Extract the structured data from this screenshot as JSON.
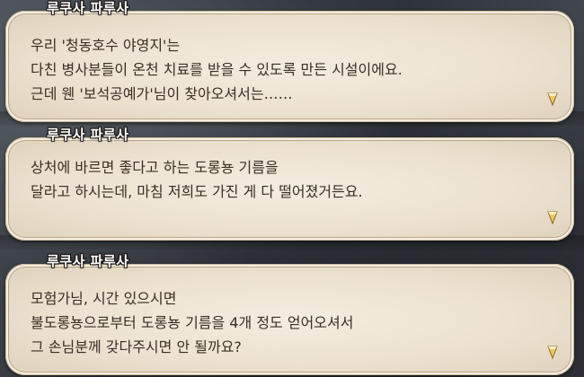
{
  "dialogues": [
    {
      "speaker": "루쿠사 파루사",
      "lines": [
        "우리 '청동호수 야영지'는",
        "다친 병사분들이 온천 치료를 받을 수 있도록 만든 시설이에요.",
        "근데 웬 '보석공예가'님이 찾아오셔서는……"
      ],
      "indicator_icon": "gem-next-icon"
    },
    {
      "speaker": "루쿠사 파루사",
      "lines": [
        "상처에 바르면 좋다고 하는 도롱뇽 기름을",
        "달라고 하시는데, 마침 저희도 가진 게 다 떨어졌거든요."
      ],
      "indicator_icon": "gem-next-icon"
    },
    {
      "speaker": "루쿠사 파루사",
      "lines": [
        "모험가님, 시간 있으시면",
        "불도롱뇽으로부터 도롱뇽 기름을 4개 정도 얻어오셔서",
        "그 손님분께 갖다주시면 안 될까요?"
      ],
      "indicator_icon": "gem-next-icon"
    }
  ],
  "colors": {
    "bubble_fill": "#efe5d6",
    "bubble_border": "#b9a588",
    "body_text": "#3a2e25",
    "speaker_text": "#ffffff",
    "gem_fill": "#f3c85a"
  }
}
